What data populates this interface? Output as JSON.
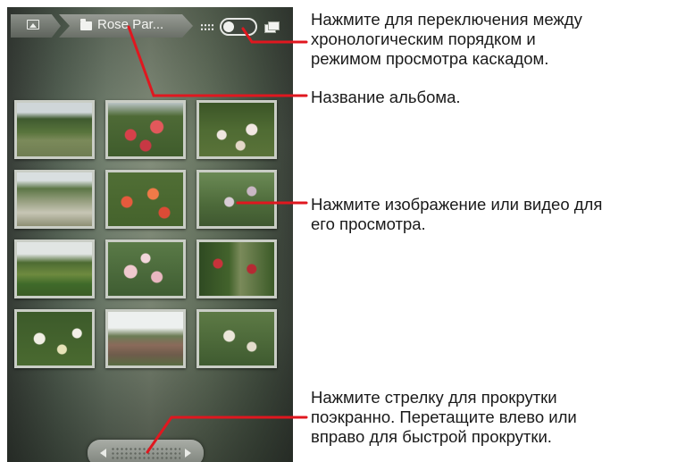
{
  "header": {
    "album_title": "Rose Par..."
  },
  "icons": {
    "gallery": "gallery-icon",
    "folder": "folder-icon",
    "grid_view": "grid-view-icon",
    "stack_view": "stack-view-icon"
  },
  "callouts": {
    "toggle_mode": "Нажмите для переключения между\nхронологическим порядком и\nрежимом просмотра каскадом.",
    "album_name": "Название альбома.",
    "tap_item": "Нажмите изображение или видео для\nего просмотра.",
    "scroll_arrow": "Нажмите стрелку для прокрутки\nпоэкранно. Перетащите влево или\nвправо для быстрой прокрутки."
  },
  "colors": {
    "callout_line": "#e0171f",
    "thumb_border": "#c9cdc5"
  },
  "thumbnails_count": 12
}
